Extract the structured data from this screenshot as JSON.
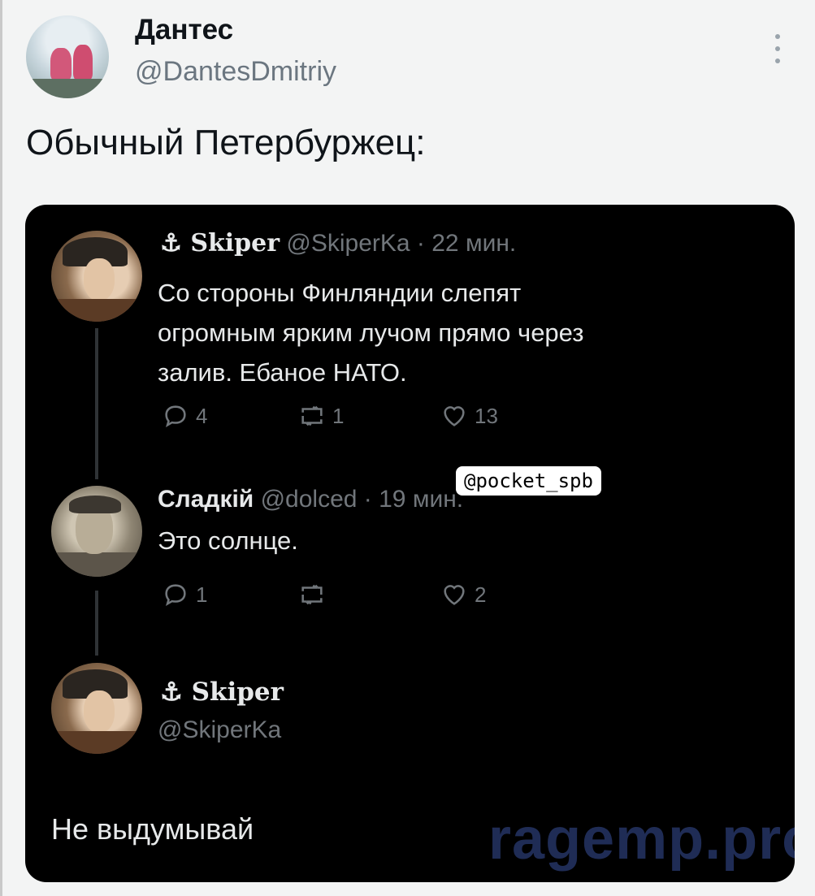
{
  "post": {
    "author_name": "Дантес",
    "author_handle": "@DantesDmitriy",
    "text": "Обычный Петербуржец:",
    "menu_icon": "more-vertical-icon"
  },
  "screenshot": {
    "tweet1": {
      "name": "⚓︎ Skiper",
      "name_icon": "anchor-icon",
      "meta": "@SkiperKa · 22 мин.",
      "lines": [
        "Со стороны Финляндии слепят",
        "огромным ярким лучом прямо через",
        "залив. Ебаное НАТО."
      ],
      "replies": "4",
      "retweets": "1",
      "likes": "13"
    },
    "tweet2": {
      "name": "Сладкій",
      "meta": "@dolced · 19 мин.",
      "text": "Это солнце.",
      "replies": "1",
      "retweets": "",
      "likes": "2"
    },
    "tweet3": {
      "name": "⚓︎ Skiper",
      "handle": "@SkiperKa",
      "text": "Не выдумывай"
    },
    "watermark_tag": "@pocket_spb",
    "watermark_site": "ragemp.pro"
  }
}
